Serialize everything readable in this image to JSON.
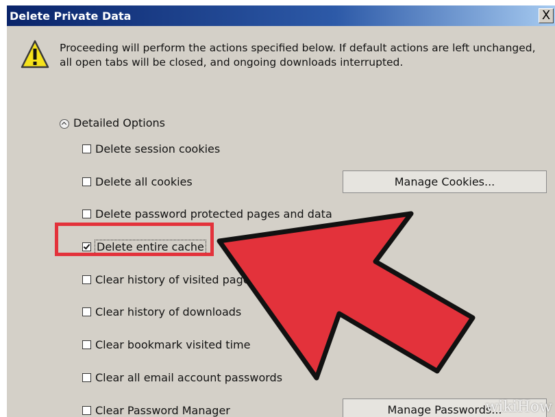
{
  "dialog": {
    "title": "Delete Private Data",
    "close_label": "X",
    "warning_text": "Proceeding will perform the actions specified below. If default actions are left unchanged, all open tabs will be closed, and ongoing downloads interrupted.",
    "detailed_options_label": "Detailed Options",
    "options": [
      {
        "label": "Delete session cookies",
        "checked": false
      },
      {
        "label": "Delete all cookies",
        "checked": false
      },
      {
        "label": "Delete password protected pages and data",
        "checked": false
      },
      {
        "label": "Delete entire cache",
        "checked": true
      },
      {
        "label": "Clear history of visited pages",
        "checked": false
      },
      {
        "label": "Clear history of downloads",
        "checked": false
      },
      {
        "label": "Clear bookmark visited time",
        "checked": false
      },
      {
        "label": "Clear all email account passwords",
        "checked": false
      },
      {
        "label": "Clear Password Manager",
        "checked": false
      }
    ],
    "buttons": {
      "manage_cookies": "Manage Cookies...",
      "manage_passwords": "Manage Passwords..."
    }
  },
  "overlay": {
    "highlight_color": "#e3323b",
    "arrow_color": "#e3323b",
    "watermark": "wikiHow"
  }
}
